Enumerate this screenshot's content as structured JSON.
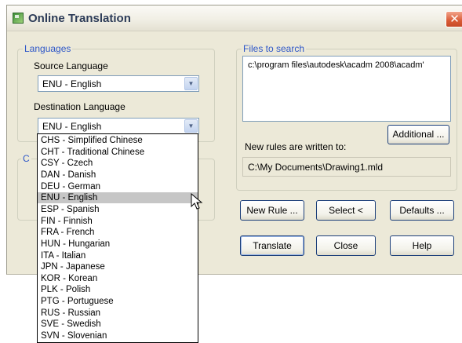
{
  "window": {
    "title": "Online Translation",
    "close_glyph": "✕"
  },
  "languages": {
    "group_label": "Languages",
    "source_label": "Source Language",
    "source_value": "ENU - English",
    "destination_label": "Destination Language",
    "destination_value": "ENU - English",
    "hidden_group_initial": "C"
  },
  "dropdown": {
    "options": [
      {
        "label": "CHS - Simplified Chinese",
        "selected": false
      },
      {
        "label": "CHT - Traditional Chinese",
        "selected": false
      },
      {
        "label": "CSY - Czech",
        "selected": false
      },
      {
        "label": "DAN - Danish",
        "selected": false
      },
      {
        "label": "DEU - German",
        "selected": false
      },
      {
        "label": "ENU - English",
        "selected": true
      },
      {
        "label": "ESP - Spanish",
        "selected": false
      },
      {
        "label": "FIN - Finnish",
        "selected": false
      },
      {
        "label": "FRA - French",
        "selected": false
      },
      {
        "label": "HUN - Hungarian",
        "selected": false
      },
      {
        "label": "ITA - Italian",
        "selected": false
      },
      {
        "label": "JPN - Japanese",
        "selected": false
      },
      {
        "label": "KOR - Korean",
        "selected": false
      },
      {
        "label": "PLK - Polish",
        "selected": false
      },
      {
        "label": "PTG - Portuguese",
        "selected": false
      },
      {
        "label": "RUS - Russian",
        "selected": false
      },
      {
        "label": "SVE - Swedish",
        "selected": false
      },
      {
        "label": "SVN - Slovenian",
        "selected": false
      }
    ]
  },
  "files": {
    "group_label": "Files to search",
    "list_items": [
      "c:\\program files\\autodesk\\acadm 2008\\acadm'"
    ],
    "additional_button": "Additional ...",
    "rules_label": "New rules are written to:",
    "rules_path": "C:\\My Documents\\Drawing1.mld"
  },
  "buttons": {
    "new_rule": "New Rule ...",
    "select": "Select <",
    "defaults": "Defaults ...",
    "translate": "Translate",
    "close": "Close",
    "help": "Help"
  },
  "icons": {
    "app": "translation-app-icon",
    "combo_arrow": "chevron-down-icon",
    "cursor": "mouse-pointer-icon"
  }
}
